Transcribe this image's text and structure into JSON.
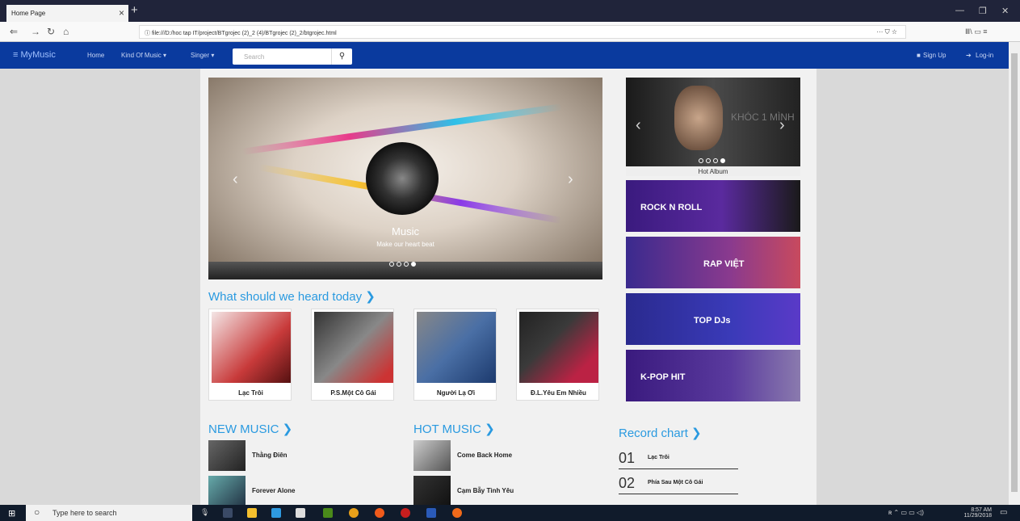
{
  "browser": {
    "tab_title": "Home Page",
    "url": "file:///D:/hoc tap IT/project/BTgrojec (2)_2 (4)/BTgrojec (2)_2/btgrojec.html",
    "url_actions": "··· ⛉ ☆",
    "right_icons": "Ⅲ\\ ▭ ≡"
  },
  "site_nav": {
    "brand": "≡ MyMusic",
    "home": "Home",
    "kind": "Kind Of Music ▾",
    "singer": "Singer ▾",
    "search_placeholder": "Search",
    "search_icon": "🔍",
    "signup": "Sign Up",
    "login": "Log-in"
  },
  "slider": {
    "caption_title": "Music",
    "caption_sub": "Make our heart beat"
  },
  "today": {
    "heading": "What should we heard today",
    "cards": [
      "Lạc Trôi",
      "P.S.Một Cô Gái",
      "Người Lạ Ơi",
      "Đ.L.Yêu Em Nhiều"
    ]
  },
  "hot_album": {
    "caption": "Hot Album",
    "image_text": "KHÓC 1 MÌNH"
  },
  "genres": [
    "ROCK N ROLL",
    "RAP VIỆT",
    "TOP DJs",
    "K-POP HIT"
  ],
  "new_music": {
    "heading": "NEW MUSIC",
    "items": [
      "Thằng Điên",
      "Forever Alone"
    ]
  },
  "hot_music": {
    "heading": "HOT MUSIC",
    "items": [
      "Come Back Home",
      "Cạm Bẫy Tình Yêu"
    ]
  },
  "record_chart": {
    "heading": "Record chart",
    "items": [
      {
        "num": "01",
        "name": "Lạc Trôi"
      },
      {
        "num": "02",
        "name": "Phía Sau Một Cô Gái"
      }
    ]
  },
  "taskbar": {
    "search_placeholder": "Type here to search",
    "time": "8:57 AM",
    "date": "11/29/2018"
  }
}
